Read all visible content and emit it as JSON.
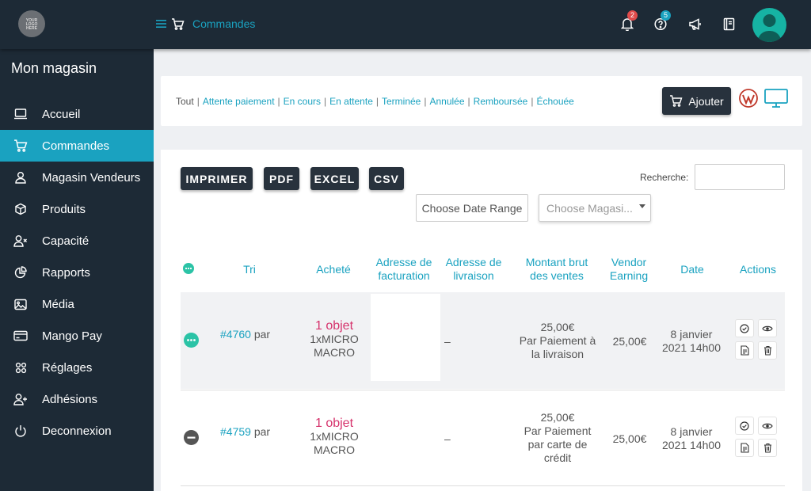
{
  "logo": {
    "text": "YOUR LOGO HERE"
  },
  "header": {
    "breadcrumb": "Commandes",
    "notifications_count": "2",
    "help_count": "5"
  },
  "sidebar": {
    "store_name": "Mon magasin",
    "items": [
      {
        "label": "Accueil",
        "icon": "laptop-icon"
      },
      {
        "label": "Commandes",
        "icon": "cart-icon",
        "active": true
      },
      {
        "label": "Magasin Vendeurs",
        "icon": "user-icon"
      },
      {
        "label": "Produits",
        "icon": "box-icon"
      },
      {
        "label": "Capacité",
        "icon": "user-x-icon"
      },
      {
        "label": "Rapports",
        "icon": "pie-chart-icon"
      },
      {
        "label": "Média",
        "icon": "image-icon"
      },
      {
        "label": "Mango Pay",
        "icon": "credit-card-icon"
      },
      {
        "label": "Réglages",
        "icon": "settings-icon"
      },
      {
        "label": "Adhésions",
        "icon": "user-plus-icon"
      },
      {
        "label": "Deconnexion",
        "icon": "power-icon"
      }
    ]
  },
  "filters": {
    "items": [
      "Tout",
      "Attente paiement",
      "En cours",
      "En attente",
      "Terminée",
      "Annulée",
      "Remboursée",
      "Échouée"
    ],
    "add_label": "Ajouter"
  },
  "export": {
    "print": "IMPRIMER",
    "pdf": "PDF",
    "excel": "EXCEL",
    "csv": "CSV"
  },
  "search": {
    "label": "Recherche:",
    "value": ""
  },
  "date_range": {
    "label": "Choose Date Range"
  },
  "store_select": {
    "placeholder": "Choose Magasi..."
  },
  "table": {
    "headers": {
      "sort": "Tri",
      "bought": "Acheté",
      "billing_1": "Adresse de",
      "billing_2": "facturation",
      "shipping_1": "Adresse de",
      "shipping_2": "livraison",
      "gross_1": "Montant brut",
      "gross_2": "des ventes",
      "vendor_1": "Vendor",
      "vendor_2": "Earning",
      "date": "Date",
      "actions": "Actions"
    },
    "rows": [
      {
        "order": "#4760",
        "by": "par",
        "objects": "1 objet",
        "product_1": "1xMICRO",
        "product_2": "MACRO",
        "shipping": "–",
        "gross_amount": "25,00€",
        "gross_1": "Par Paiement à",
        "gross_2": "la livraison",
        "gross_3": "",
        "earning": "25,00€",
        "date_1": "8 janvier",
        "date_2": "2021 14h00",
        "status": "processing"
      },
      {
        "order": "#4759",
        "by": "par",
        "objects": "1 objet",
        "product_1": "1xMICRO",
        "product_2": "MACRO",
        "shipping": "–",
        "gross_amount": "25,00€",
        "gross_1": "Par Paiement",
        "gross_2": "par carte de",
        "gross_3": "crédit",
        "earning": "25,00€",
        "date_1": "8 janvier",
        "date_2": "2021 14h00",
        "status": "cancelled"
      }
    ]
  },
  "colors": {
    "accent": "#1aa2c0",
    "sidebar": "#1d2a36",
    "objects": "#d6336c",
    "processing": "#2bc3a6",
    "cancelled": "#555555"
  }
}
